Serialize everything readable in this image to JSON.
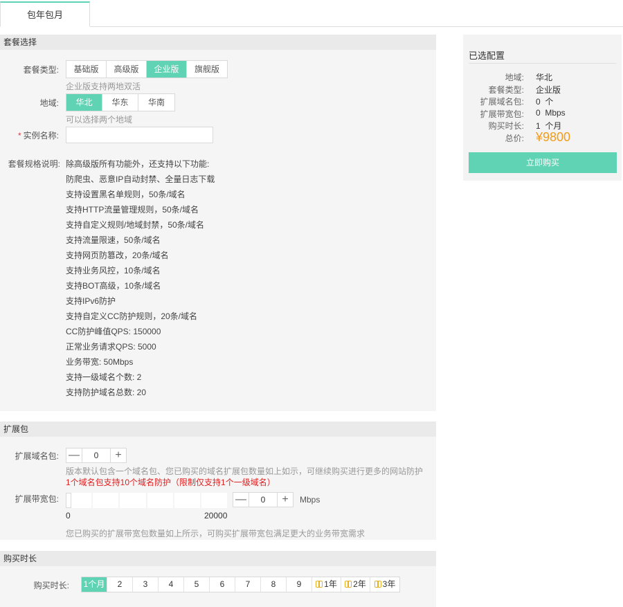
{
  "tabs": {
    "active": "包年包月"
  },
  "plan_section": {
    "title": "套餐选择",
    "type_label": "套餐类型:",
    "types": [
      "基础版",
      "高级版",
      "企业版",
      "旗舰版"
    ],
    "type_selected": "企业版",
    "type_hint": "企业版支持两地双活",
    "region_label": "地域:",
    "regions": [
      "华北",
      "华东",
      "华南"
    ],
    "region_selected": "华北",
    "region_hint": "可以选择两个地域",
    "instance_label": "实例名称:",
    "instance_required": "*",
    "instance_value": "",
    "spec_label": "套餐规格说明:",
    "spec_lines": [
      "除高级版所有功能外，还支持以下功能:",
      "防爬虫、恶意IP自动封禁、全量日志下载",
      "支持设置黑名单规则，50条/域名",
      "支持HTTP流量管理规则，50条/域名",
      "支持自定义规则/地域封禁，50条/域名",
      "支持流量限速，50条/域名",
      "支持网页防篡改，20条/域名",
      "支持业务风控，10条/域名",
      "支持BOT高级，10条/域名",
      "支持IPv6防护",
      "支持自定义CC防护规则，20条/域名",
      "CC防护峰值QPS: 150000",
      "正常业务请求QPS: 5000",
      "业务带宽: 50Mbps",
      "支持一级域名个数: 2",
      "支持防护域名总数: 20"
    ]
  },
  "ext_section": {
    "title": "扩展包",
    "domain_label": "扩展域名包:",
    "domain_value": "0",
    "domain_minus": "—",
    "domain_plus": "+",
    "domain_hint": "版本默认包含一个域名包、您已购买的域名扩展包数量如上如示，可继续购买进行更多的网站防护",
    "domain_warn": "1个域名包支持10个域名防护（限制仅支持1个一级域名）",
    "bw_label": "扩展带宽包:",
    "bw_value": "0",
    "bw_minus": "—",
    "bw_plus": "+",
    "bw_unit": "Mbps",
    "bw_min": "0",
    "bw_max": "20000",
    "bw_level": 0,
    "bw_hint": "您已购买的扩展带宽包数量如上所示，可购买扩展带宽包满足更大的业务带宽需求"
  },
  "duration_section": {
    "title": "购买时长",
    "label": "购买时长:",
    "options": [
      "1个月",
      "2",
      "3",
      "4",
      "5",
      "6",
      "7",
      "8",
      "9",
      "1年",
      "2年",
      "3年"
    ],
    "selected": "1个月"
  },
  "summary": {
    "title": "已选配置",
    "region_k": "地域:",
    "region_v": "华北",
    "type_k": "套餐类型:",
    "type_v": "企业版",
    "domain_k": "扩展域名包:",
    "domain_v": "0  个",
    "bw_k": "扩展带宽包:",
    "bw_v": "0  Mbps",
    "duration_k": "购买时长:",
    "duration_v": "1  个月",
    "total_k": "总价:",
    "total_v": "¥9800",
    "buy_label": "立即购买"
  },
  "colors": {
    "accent": "#5fd3b3",
    "price": "#f39b1a",
    "warn": "#e02020"
  }
}
